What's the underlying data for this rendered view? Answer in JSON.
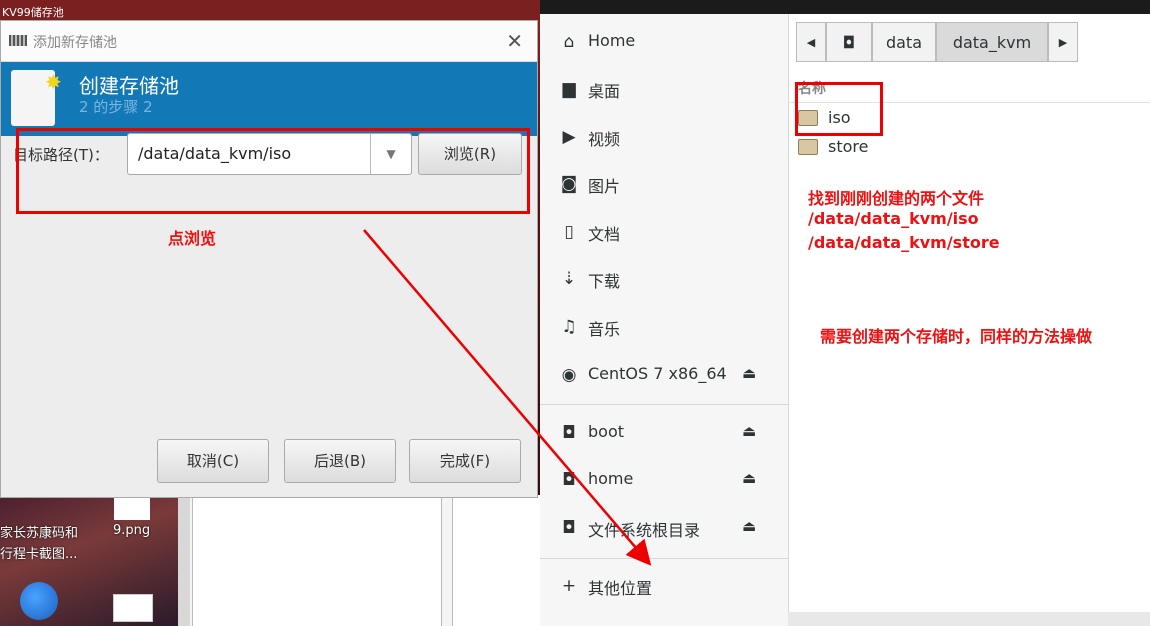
{
  "desktop": {
    "top_text": "KV99储存池",
    "icon_label_1_line1": "家长苏康码和",
    "icon_label_1_line2": "行程卡截图...",
    "icon_label_2": "9.png"
  },
  "dialog": {
    "window_title": "添加新存储池",
    "close_glyph": "✕",
    "banner_title": "创建存储池",
    "banner_step": "2 的步骤 2",
    "target_path_label": "目标路径(T)：",
    "target_path_value": "/data/data_kvm/iso",
    "combo_arrow": "▼",
    "browse_button": "浏览(R)",
    "cancel_button": "取消(C)",
    "back_button": "后退(B)",
    "finish_button": "完成(F)"
  },
  "annotations": {
    "click_browse": "点浏览",
    "found_files_line1": "找到刚刚创建的两个文件",
    "found_files_line2": "/data/data_kvm/iso",
    "found_files_line3": "/data/data_kvm/store",
    "need_two_pools": "需要创建两个存储时，同样的方法操做",
    "color": "#ee0000"
  },
  "file_chooser": {
    "sidebar": [
      {
        "label": "Home",
        "icon": "home-icon",
        "glyph": "⌂"
      },
      {
        "label": "桌面",
        "icon": "desktop-folder-icon",
        "glyph": "▆"
      },
      {
        "label": "视频",
        "icon": "video-icon",
        "glyph": "▶"
      },
      {
        "label": "图片",
        "icon": "camera-icon",
        "glyph": "◙"
      },
      {
        "label": "文档",
        "icon": "document-icon",
        "glyph": "▯"
      },
      {
        "label": "下载",
        "icon": "download-icon",
        "glyph": "⇣"
      },
      {
        "label": "音乐",
        "icon": "music-icon",
        "glyph": "♫"
      },
      {
        "label": "CentOS 7 x86_64",
        "icon": "disc-icon",
        "glyph": "◉"
      },
      {
        "label": "boot",
        "icon": "drive-icon",
        "glyph": "◘"
      },
      {
        "label": "home",
        "icon": "drive-icon",
        "glyph": "◘"
      },
      {
        "label": "文件系统根目录",
        "icon": "drive-icon",
        "glyph": "◘"
      },
      {
        "label": "其他位置",
        "icon": "plus-icon",
        "glyph": "+"
      }
    ],
    "eject_glyph": "⏏",
    "path": {
      "back_glyph": "◀",
      "root_glyph": "◘",
      "segments": [
        "data",
        "data_kvm"
      ],
      "forward_glyph": "▶"
    },
    "column_header": "名称",
    "files": [
      "iso",
      "store"
    ]
  }
}
